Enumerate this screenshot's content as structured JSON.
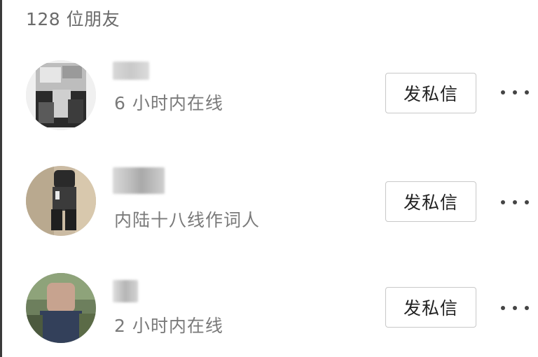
{
  "header": {
    "title": "128 位朋友"
  },
  "friends": [
    {
      "subtitle": "6 小时内在线",
      "button_label": "发私信",
      "more_icon": "more-horizontal-icon"
    },
    {
      "subtitle": "内陆十八线作词人",
      "button_label": "发私信",
      "more_icon": "more-horizontal-icon"
    },
    {
      "subtitle": "2 小时内在线",
      "button_label": "发私信",
      "more_icon": "more-horizontal-icon"
    }
  ]
}
